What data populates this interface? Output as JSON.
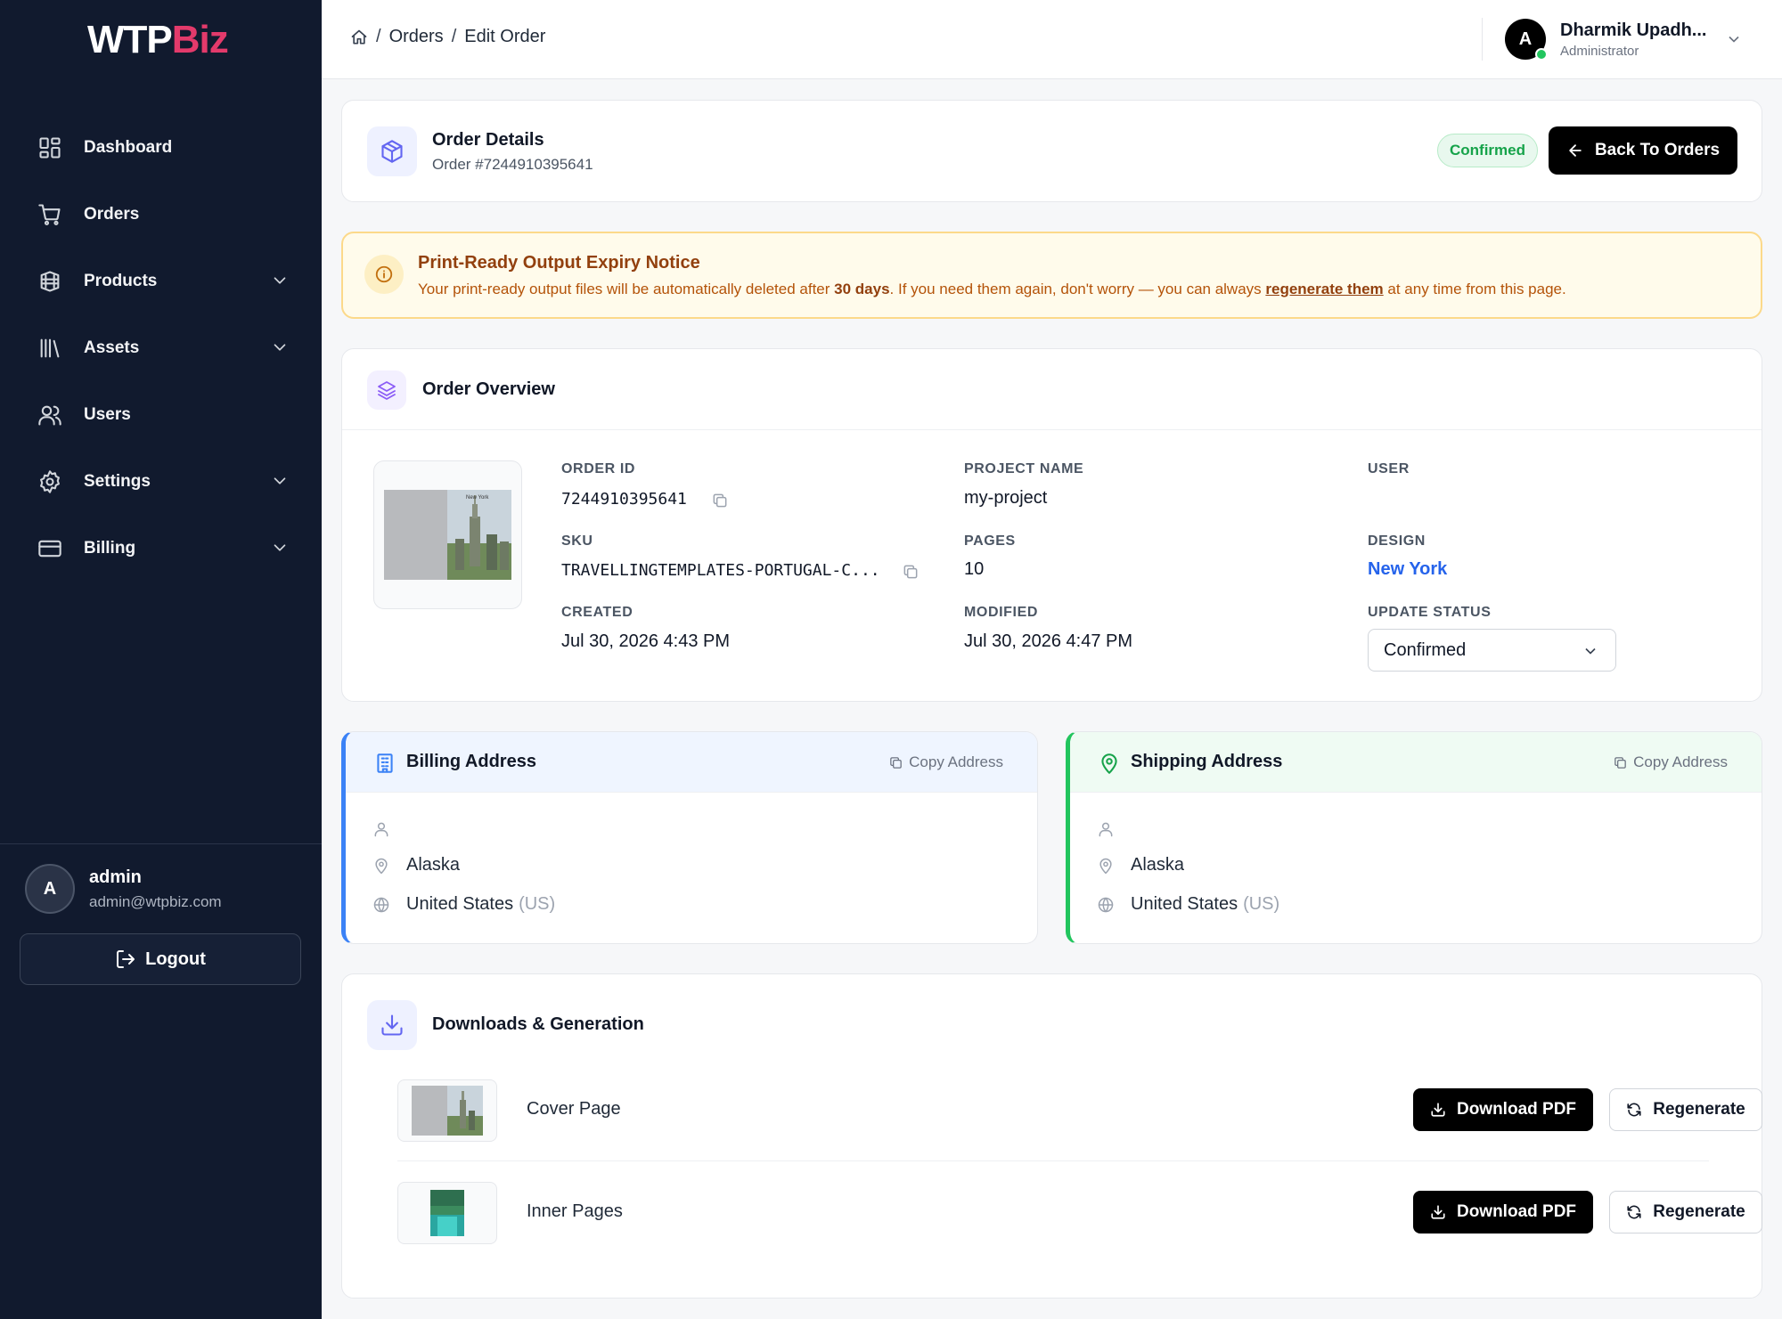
{
  "brand": {
    "logo_part1": "WTP",
    "logo_part2": "Biz",
    "logo_color": "#e33a6b"
  },
  "sidebar": {
    "items": [
      {
        "label": "Dashboard",
        "icon": "dashboard-icon",
        "expandable": false
      },
      {
        "label": "Orders",
        "icon": "cart-icon",
        "expandable": false
      },
      {
        "label": "Products",
        "icon": "products-icon",
        "expandable": true
      },
      {
        "label": "Assets",
        "icon": "library-icon",
        "expandable": true
      },
      {
        "label": "Users",
        "icon": "users-icon",
        "expandable": false
      },
      {
        "label": "Settings",
        "icon": "gear-icon",
        "expandable": true
      },
      {
        "label": "Billing",
        "icon": "credit-card-icon",
        "expandable": true
      }
    ],
    "user": {
      "initial": "A",
      "name": "admin",
      "email": "admin@wtpbiz.com"
    },
    "logout_label": "Logout"
  },
  "header": {
    "breadcrumb": [
      "Orders",
      "Edit Order"
    ],
    "user": {
      "initial": "A",
      "name": "Dharmik Upadh...",
      "role": "Administrator",
      "online_color": "#22c55e"
    }
  },
  "order_details": {
    "title": "Order Details",
    "subtitle": "Order #7244910395641",
    "status_badge": "Confirmed",
    "back_label": "Back To Orders"
  },
  "notice": {
    "title": "Print-Ready Output Expiry Notice",
    "text_before": "Your print-ready output files will be automatically deleted after ",
    "text_bold": "30 days",
    "text_middle": ". If you need them again, don't worry — you can always ",
    "link": "regenerate them",
    "text_after": " at any time from this page."
  },
  "overview": {
    "title": "Order Overview",
    "thumb_caption": "New York",
    "fields": {
      "order_id_label": "ORDER ID",
      "order_id": "7244910395641",
      "project_name_label": "PROJECT NAME",
      "project_name": "my-project",
      "user_label": "USER",
      "user": "",
      "sku_label": "SKU",
      "sku": "TRAVELLINGTEMPLATES-PORTUGAL-C...",
      "pages_label": "PAGES",
      "pages": "10",
      "design_label": "DESIGN",
      "design": "New York",
      "created_label": "CREATED",
      "created": "Jul 30, 2026 4:43 PM",
      "modified_label": "MODIFIED",
      "modified": "Jul 30, 2026 4:47 PM",
      "status_label": "UPDATE STATUS",
      "status_value": "Confirmed"
    }
  },
  "billing": {
    "title": "Billing Address",
    "copy_label": "Copy Address",
    "name": "",
    "state": "Alaska",
    "country": "United States",
    "country_code": "(US)",
    "accent": "#3b82f6"
  },
  "shipping": {
    "title": "Shipping Address",
    "copy_label": "Copy Address",
    "name": "",
    "state": "Alaska",
    "country": "United States",
    "country_code": "(US)",
    "accent": "#22c55e"
  },
  "downloads": {
    "title": "Downloads & Generation",
    "rows": [
      {
        "name": "Cover Page",
        "download_label": "Download PDF",
        "regenerate_label": "Regenerate"
      },
      {
        "name": "Inner Pages",
        "download_label": "Download PDF",
        "regenerate_label": "Regenerate"
      }
    ]
  }
}
